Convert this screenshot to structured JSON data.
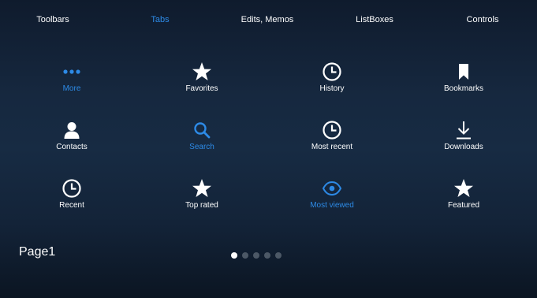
{
  "nav": {
    "items": [
      {
        "label": "Toolbars",
        "active": false
      },
      {
        "label": "Tabs",
        "active": true
      },
      {
        "label": "Edits, Memos",
        "active": false
      },
      {
        "label": "ListBoxes",
        "active": false
      },
      {
        "label": "Controls",
        "active": false
      }
    ]
  },
  "tiles": [
    {
      "label": "More",
      "icon": "more-icon",
      "active": true
    },
    {
      "label": "Favorites",
      "icon": "star-icon",
      "active": false
    },
    {
      "label": "History",
      "icon": "clock-icon",
      "active": false
    },
    {
      "label": "Bookmarks",
      "icon": "bookmark-icon",
      "active": false
    },
    {
      "label": "Contacts",
      "icon": "person-icon",
      "active": false
    },
    {
      "label": "Search",
      "icon": "search-icon",
      "active": true
    },
    {
      "label": "Most recent",
      "icon": "clock-icon",
      "active": false
    },
    {
      "label": "Downloads",
      "icon": "download-icon",
      "active": false
    },
    {
      "label": "Recent",
      "icon": "clock-icon",
      "active": false
    },
    {
      "label": "Top rated",
      "icon": "star-icon",
      "active": false
    },
    {
      "label": "Most viewed",
      "icon": "eye-icon",
      "active": true
    },
    {
      "label": "Featured",
      "icon": "star-icon",
      "active": false
    }
  ],
  "page": {
    "label": "Page1",
    "dot_count": 5,
    "current_page": 1
  },
  "colors": {
    "accent": "#2d8ae6",
    "text": "#ffffff",
    "inactive_dot": "#4c5866",
    "background_top": "#0f1b2d",
    "background_mid": "#172b43",
    "background_bottom": "#0b1522"
  }
}
